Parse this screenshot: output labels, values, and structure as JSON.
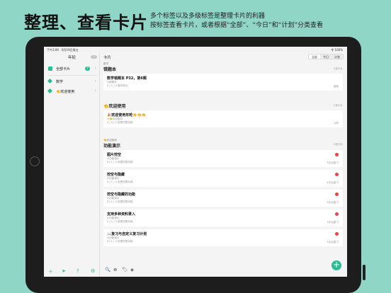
{
  "promo": {
    "title": "整理、查看卡片",
    "subtitle_line1": "多个标签以及多级标签是整理卡片的利器",
    "subtitle_line2": "按标签查看卡片，或者根据“全部”、“今日”和“计划”分类查看"
  },
  "status": {
    "time": "下午2:00　6月19日周五",
    "right": "令 100%"
  },
  "sidebar": {
    "title": "年轮",
    "items": [
      {
        "label": "全部卡片",
        "count": "7",
        "icon_color": "#2bbd94"
      },
      {
        "label": "数学",
        "icon_color": "#2bbd94"
      },
      {
        "label": "👏欢迎使用",
        "icon_color": "#2bbd94"
      }
    ],
    "bottom_icons": [
      "＋",
      "➤",
      "?",
      "⚙"
    ]
  },
  "main": {
    "header": "卡片",
    "segments": [
      "全部",
      "今日",
      "计划"
    ],
    "active_segment": "全部",
    "sections": [
      {
        "pre": "数学",
        "title": "错题本",
        "count": "1张卡片",
        "cards": [
          {
            "title": "数学错题本 P32，第6题",
            "tag": "#错题本",
            "meta": "0 / 1 / 0  复印笔记",
            "right": "困难"
          }
        ]
      },
      {
        "pre": "",
        "title": "👏欢迎使用",
        "count": "1张卡片",
        "cards": [
          {
            "title": "🎉欢迎使用年轮👏👏👏",
            "tag": "#👏欢迎使用",
            "meta": "0 / 4 / 0  查看完整功能",
            "right": "计划"
          }
        ]
      },
      {
        "pre": "👏欢迎使用",
        "title": "功能演示",
        "count": "5张卡片",
        "cards": [
          {
            "title": "图片挖空",
            "tag": "#功能演示",
            "meta": "0 / 1 / 0  查看完整功能",
            "right": "3天后复习"
          },
          {
            "title": "挖空与隐藏",
            "tag": "#功能演示",
            "meta": "0 / 1 / 0  查看完整功能",
            "right": "4天后复习"
          },
          {
            "title": "挖空与隐藏的功能",
            "tag": "#功能演示",
            "meta": "0 / 1 / 0  查看完整功能",
            "right": "3天后复习"
          },
          {
            "title": "支持多种资料录入",
            "tag": "#功能演示",
            "meta": "0 / 1 / 0  查看完整功能",
            "right": "3天后复习"
          },
          {
            "title": "📖复习与自定义复习计划",
            "tag": "#功能演示",
            "meta": "0 / 1 / 0  查看完整功能",
            "right": "3天后复习"
          }
        ]
      }
    ],
    "bottom_icons": [
      "🔍",
      "⊕",
      "🏷",
      "◈"
    ],
    "fab": "+"
  }
}
